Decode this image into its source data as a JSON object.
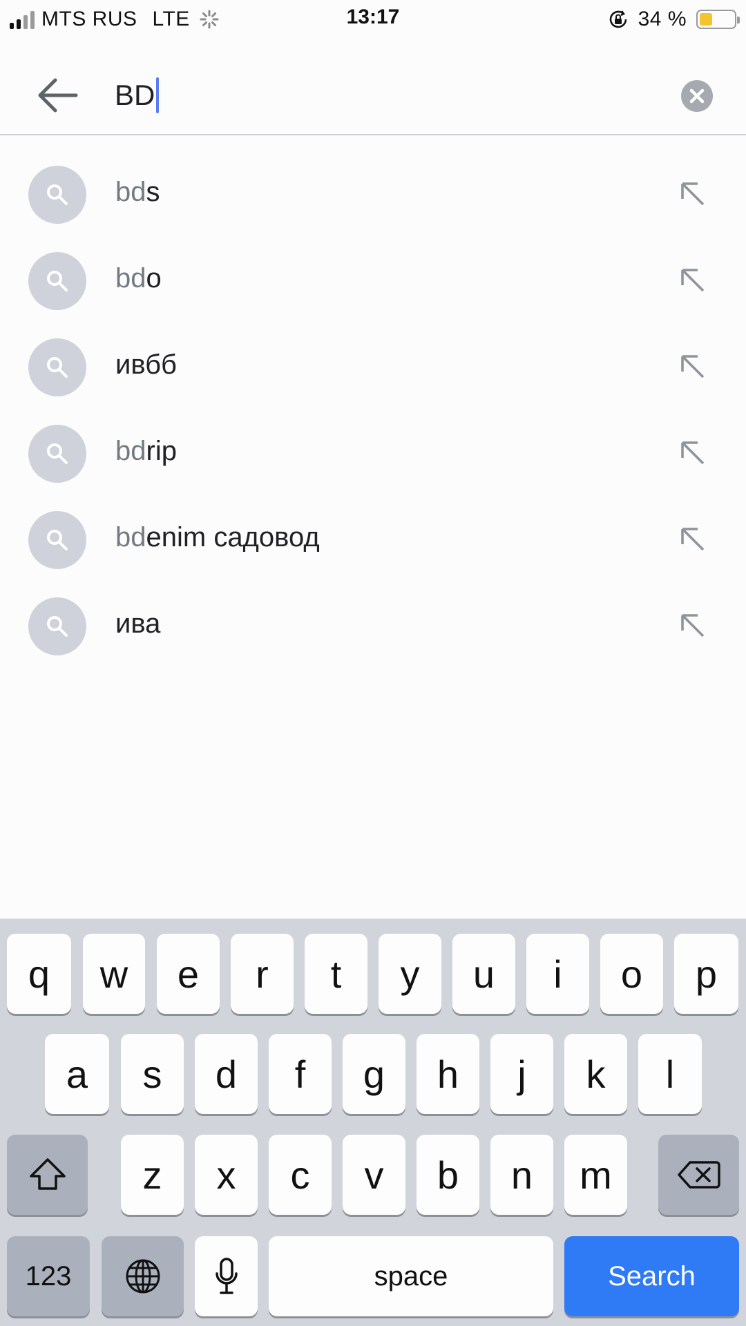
{
  "status_bar": {
    "carrier": "MTS RUS",
    "network": "LTE",
    "time": "13:17",
    "battery": "34 %",
    "battery_level": 0.34,
    "colors": {
      "battery_fill": "#f5c32c"
    },
    "icons": [
      "signal-icon",
      "loading-spinner-icon",
      "orientation-lock-icon",
      "battery-icon"
    ]
  },
  "search": {
    "query": "BD",
    "icons": {
      "back": "arrow-left-icon",
      "clear": "clear-circle-icon"
    },
    "caret_color": "#5c7cf3"
  },
  "suggestions": [
    {
      "match": "bd",
      "rest": "s"
    },
    {
      "match": "bd",
      "rest": "o"
    },
    {
      "match": "",
      "rest": "ивбб"
    },
    {
      "match": "bd",
      "rest": "rip"
    },
    {
      "match": "bd",
      "rest": "enim садовод"
    },
    {
      "match": "",
      "rest": "ива"
    }
  ],
  "suggestion_icons": {
    "leading": "search-icon",
    "trailing": "arrow-up-left-icon"
  },
  "keyboard": {
    "row1": [
      "q",
      "w",
      "e",
      "r",
      "t",
      "y",
      "u",
      "i",
      "o",
      "p"
    ],
    "row2": [
      "a",
      "s",
      "d",
      "f",
      "g",
      "h",
      "j",
      "k",
      "l"
    ],
    "row3": [
      "z",
      "x",
      "c",
      "v",
      "b",
      "n",
      "m"
    ],
    "numbers": "123",
    "space": "space",
    "search": "Search",
    "icons": [
      "shift-icon",
      "backspace-icon",
      "globe-icon",
      "microphone-icon"
    ],
    "colors": {
      "search_key": "#2f7bf5",
      "background": "#d1d4db"
    }
  }
}
